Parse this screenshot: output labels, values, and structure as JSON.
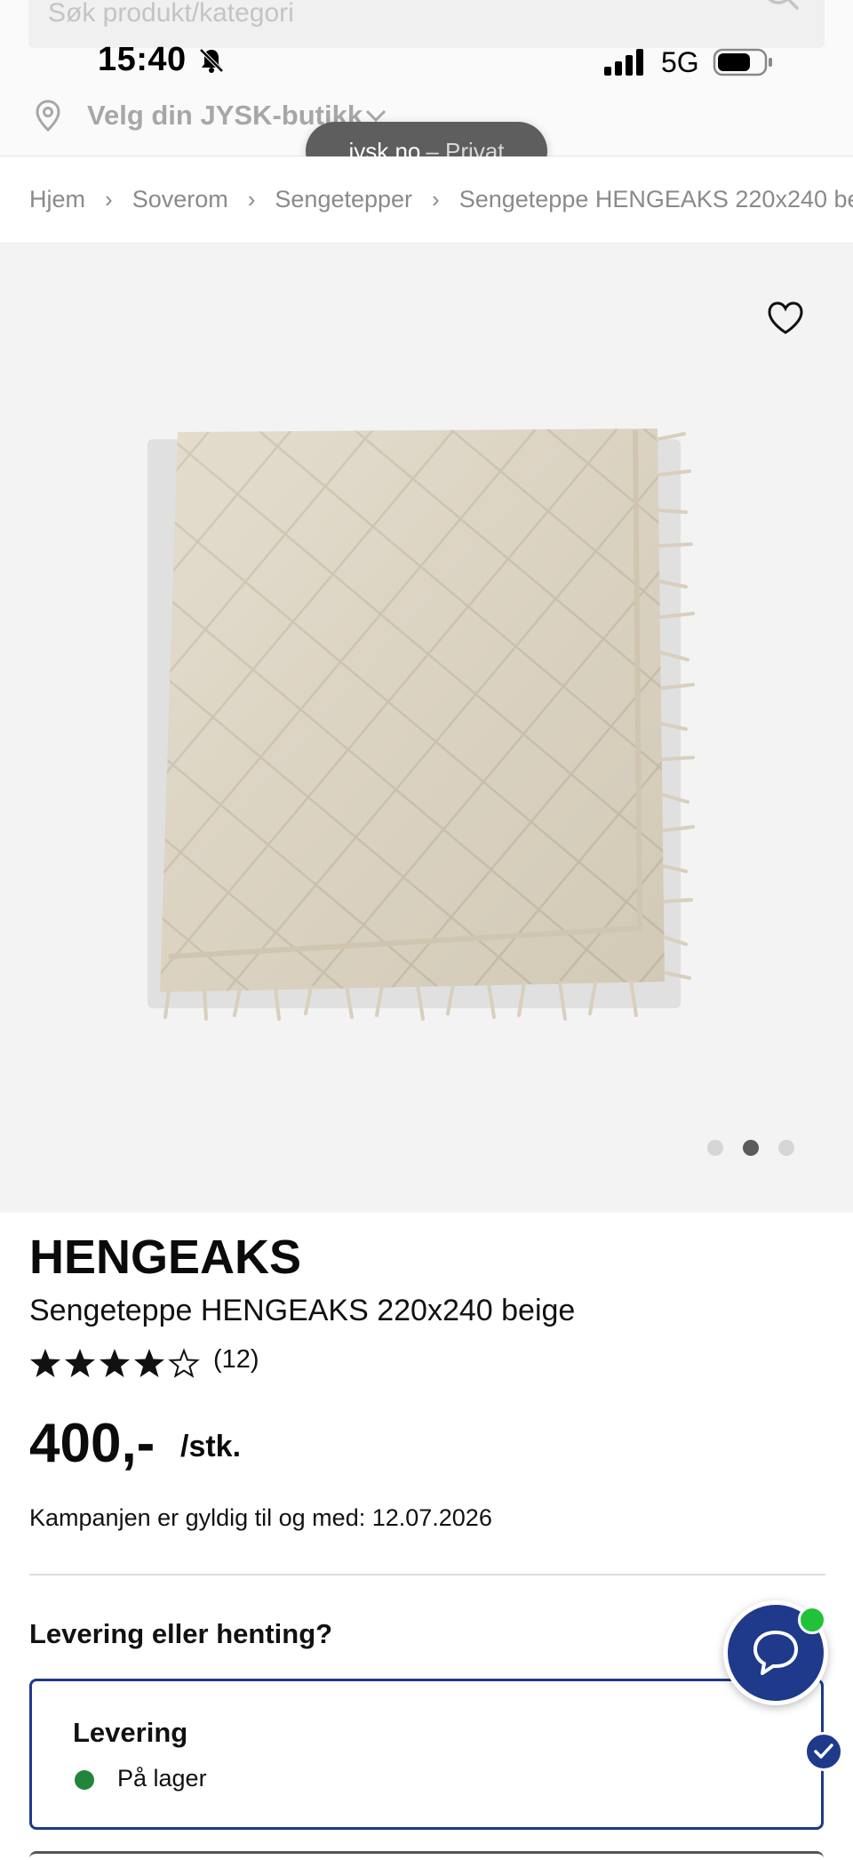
{
  "status_bar": {
    "time": "15:40",
    "network": "5G"
  },
  "header": {
    "search_placeholder": "Søk produkt/kategori",
    "store_label": "Velg din JYSK-butikk"
  },
  "url_pill": {
    "domain": "jysk.no",
    "mode": "– Privat"
  },
  "breadcrumb": {
    "items": [
      "Hjem",
      "Soverom",
      "Sengetepper",
      "Sengeteppe HENGEAKS 220x240 be"
    ],
    "separator": "›"
  },
  "gallery": {
    "dots": 3,
    "active_dot": 2
  },
  "product": {
    "brand": "HENGEAKS",
    "title": "Sengeteppe HENGEAKS 220x240 beige",
    "rating": 4,
    "rating_max": 5,
    "rating_count": "(12)",
    "price": "400,-",
    "price_unit": "/stk.",
    "campaign_text": "Kampanjen er gyldig til og med: 12.07.2026"
  },
  "delivery": {
    "heading": "Levering eller henting?",
    "option_title": "Levering",
    "stock_status": "På lager",
    "stock_color": "#22853c",
    "selected": true
  },
  "colors": {
    "brand_blue": "#1f3a8a",
    "chat_online": "#21c23a"
  },
  "icons": [
    "search-icon",
    "bell-slash-icon",
    "signal-icon",
    "battery-icon",
    "pin-icon",
    "chevron-down-icon",
    "heart-icon",
    "star-icon",
    "check-icon",
    "chat-icon"
  ]
}
